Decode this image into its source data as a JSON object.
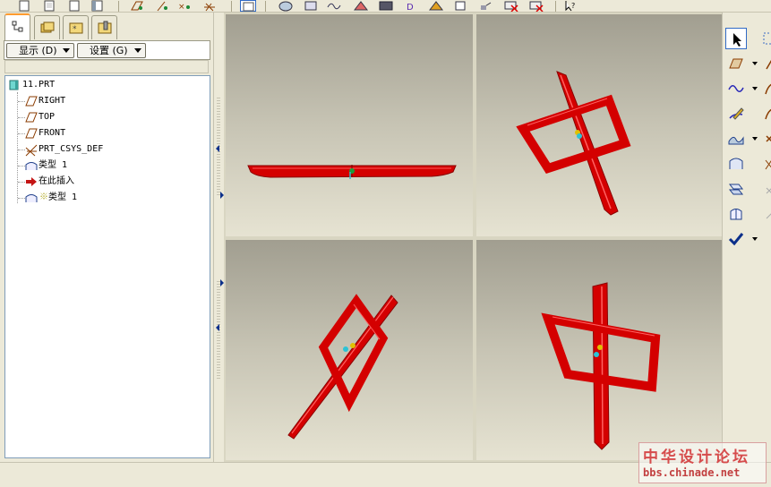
{
  "tree_toolbar": {
    "show_label": "显示 (D)",
    "settings_label": "设置 (G)"
  },
  "model_tree": {
    "items": [
      {
        "label": "11.PRT",
        "icon": "part-icon"
      },
      {
        "label": "RIGHT",
        "icon": "datum-plane-icon"
      },
      {
        "label": "TOP",
        "icon": "datum-plane-icon"
      },
      {
        "label": "FRONT",
        "icon": "datum-plane-icon"
      },
      {
        "label": "PRT_CSYS_DEF",
        "icon": "coordinate-system-icon"
      },
      {
        "label": "类型 1",
        "icon": "surface-feature-icon"
      },
      {
        "label": "在此插入",
        "icon": "insert-here-arrow-icon"
      },
      {
        "label": "类型 1",
        "icon": "suppressed-surface-feature-icon"
      }
    ]
  },
  "watermark": {
    "title": "中华设计论坛",
    "url": "bbs.chinade.net"
  },
  "colors": {
    "model_red": "#d40000",
    "accent_blue": "#0b2f8a",
    "tab_highlight": "#ff9b2f"
  }
}
